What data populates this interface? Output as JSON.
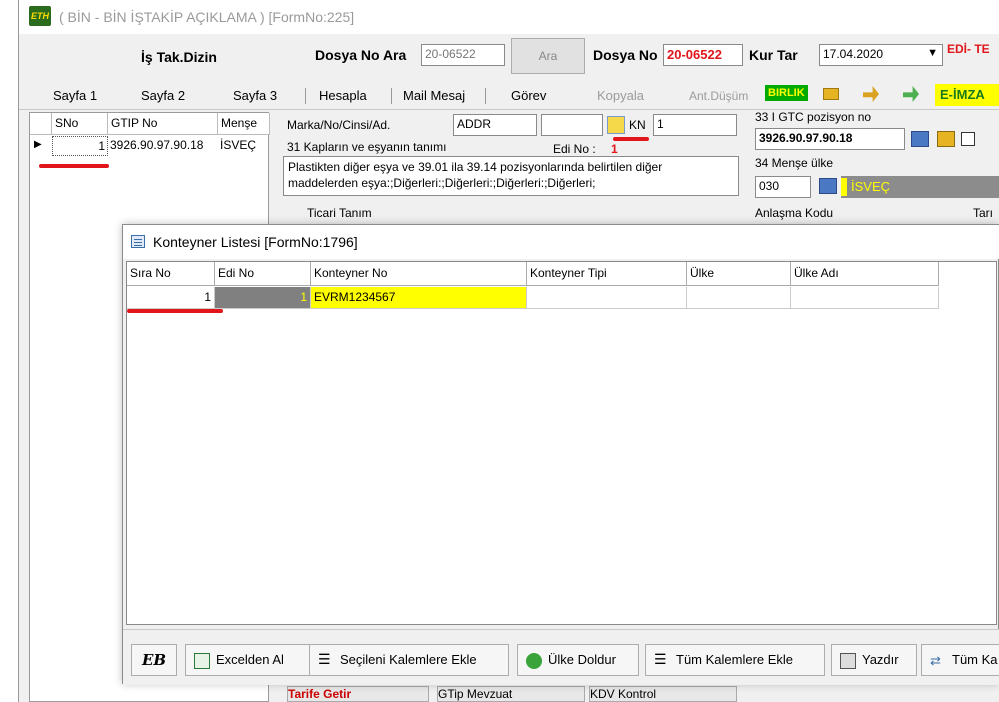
{
  "title": {
    "text": "( BİN - BİN İŞTAKİP AÇIKLAMA ) [FormNo:225]",
    "logo_text": "ETH"
  },
  "header": {
    "is_tak_dizin": "İş Tak.Dizin",
    "dosya_no_ara_label": "Dosya No Ara",
    "dosya_no_ara_value": "20-06522",
    "ara_button": "Ara",
    "dosya_no_label": "Dosya No",
    "dosya_no_value": "20-06522",
    "kur_tar_label": "Kur Tar",
    "kur_tar_value": "17.04.2020",
    "edi_label": "EDİ- TE"
  },
  "tabs": [
    {
      "label": "Sayfa 1"
    },
    {
      "label": "Sayfa 2"
    },
    {
      "label": "Sayfa 3"
    },
    {
      "label": "Hesapla"
    },
    {
      "label": "Mail Mesaj"
    },
    {
      "label": "Görev"
    },
    {
      "label": "Kopyala"
    },
    {
      "label": "Ant.Düşüm"
    }
  ],
  "toolbar": {
    "birlik": "BIRLIK",
    "e_imza": "E-İMZA"
  },
  "left_grid": {
    "columns": [
      "SNo",
      "GTIP No",
      "Menşe"
    ],
    "rows": [
      {
        "sno": "1",
        "gtip": "3926.90.97.90.18",
        "mense": "İSVEÇ"
      }
    ]
  },
  "form": {
    "marka_label": "Marka/No/Cinsi/Ad.",
    "marka_value": "ADDR",
    "kn_label": "KN",
    "kn_value": "1",
    "kaplar_label": "31 Kapların ve eşyanın tanımı",
    "edi_no_label": "Edi No :",
    "edi_no_value": "1",
    "description": "Plastikten diğer eşya ve 39.01 ila 39.14 pozisyonlarında belirtilen diğer maddelerden eşya:;Diğerleri:;Diğerleri:;Diğerleri:;Diğerleri;",
    "ticari_tanim_label": "Ticari Tanım",
    "gtc_label": "33 I GTC pozisyon no",
    "gtc_value": "3926.90.97.90.18",
    "mense_label": "34 Menşe ülke",
    "mense_code": "030",
    "mense_name": "İSVEÇ",
    "anlasma_label": "Anlaşma Kodu",
    "tar_label": "Tarı"
  },
  "dialog": {
    "title": "Konteyner Listesi [FormNo:1796]",
    "columns": [
      "Sıra No",
      "Edi No",
      "Konteyner No",
      "Konteyner Tipi",
      "Ülke",
      "Ülke Adı"
    ],
    "rows": [
      {
        "sira_no": "1",
        "edi_no": "1",
        "konteyner_no": "EVRM1234567",
        "konteyner_tipi": "",
        "ulke": "",
        "ulke_adi": ""
      }
    ],
    "buttons": {
      "logo": "EB",
      "excelden_al": "Excelden Al",
      "secileni": "Seçileni Kalemlere Ekle",
      "ulke_doldur": "Ülke Doldur",
      "tum_kalemlere": "Tüm Kalemlere Ekle",
      "yazdir": "Yazdır",
      "tum_ka": "Tüm Ka"
    }
  },
  "bottom": {
    "tarife": "Tarife Getir",
    "gtip": "GTip Mevzuat",
    "kdv": "KDV Kontrol"
  },
  "colors": {
    "yellow": "#ffff00",
    "red": "#e0161b",
    "green": "#00cc00",
    "grey_cell": "#808080",
    "navy_bar": "#8c8c8c"
  }
}
